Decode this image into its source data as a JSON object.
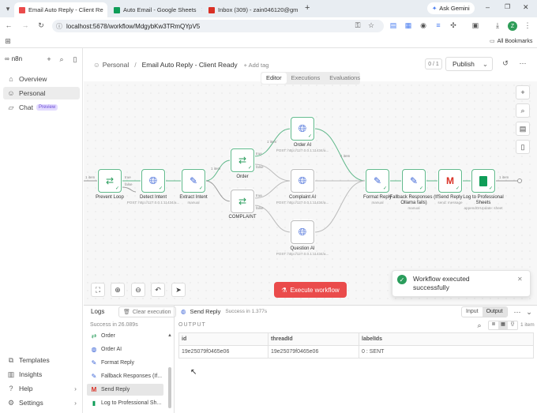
{
  "browser": {
    "tabs": [
      {
        "title": "Email Auto Reply - Client Re",
        "fav_color": "#ea4b4b",
        "active": true
      },
      {
        "title": "Auto Email - Google Sheets",
        "fav_color": "#0f9d58",
        "active": false
      },
      {
        "title": "Inbox (309) - zain046120@gm",
        "fav_color": "#d93025",
        "active": false
      }
    ],
    "ask_gemini": "Ask Gemini",
    "url": "localhost:5678/workflow/MdgybKw3TRmQYpV5",
    "all_bookmarks": "All Bookmarks",
    "profile_initial": "Z"
  },
  "sidebar": {
    "logo": "n8n",
    "items": [
      {
        "label": "Overview",
        "icon": "home-icon"
      },
      {
        "label": "Personal",
        "icon": "user-icon"
      },
      {
        "label": "Chat",
        "icon": "chat-icon",
        "badge": "Preview"
      }
    ],
    "bottom_items": [
      {
        "label": "Templates",
        "icon": "templates-icon"
      },
      {
        "label": "Insights",
        "icon": "insights-icon"
      },
      {
        "label": "Help",
        "icon": "help-icon"
      },
      {
        "label": "Settings",
        "icon": "settings-icon"
      }
    ]
  },
  "header": {
    "breadcrumb_project": "Personal",
    "workflow_name": "Email Auto Reply - Client Ready",
    "add_tag": "+ Add tag",
    "counter": "0 / 1",
    "publish": "Publish",
    "tabs": [
      {
        "label": "Editor",
        "active": true
      },
      {
        "label": "Executions",
        "active": false
      },
      {
        "label": "Evaluations",
        "active": false
      }
    ]
  },
  "nodes": {
    "prevent_loop": {
      "label": "Prevent Loop",
      "sub": ""
    },
    "detect_intent": {
      "label": "Detect Intent",
      "sub": "POST: http://127.0.0.1:11434/a..."
    },
    "extract_intent": {
      "label": "Extract Intent",
      "sub": "manual"
    },
    "order": {
      "label": "Order",
      "sub": ""
    },
    "complaint": {
      "label": "COMPLAINT",
      "sub": ""
    },
    "order_ai": {
      "label": "Order AI",
      "sub": "POST: http://127.0.0.1:11434/a..."
    },
    "complaint_ai": {
      "label": "Complaint AI",
      "sub": "POST: http://127.0.0.1:11434/a..."
    },
    "question_ai": {
      "label": "Question AI",
      "sub": "POST: http://127.0.0.1:11434/a..."
    },
    "format_reply": {
      "label": "Format Reply",
      "sub": "manual"
    },
    "fallback": {
      "label": "Fallback Responses (If Ollama fails)",
      "sub": "manual"
    },
    "send_reply": {
      "label": "Send Reply",
      "sub": "send: message"
    },
    "log_sheets": {
      "label": "Log to Professional Sheets",
      "sub": "appendOrUpdate: sheet"
    }
  },
  "edges": {
    "item": "1 item",
    "true": "true",
    "false": "false"
  },
  "canvas": {
    "execute_button": "Execute workflow"
  },
  "toast": {
    "message": "Workflow executed successfully"
  },
  "logs": {
    "title": "Logs",
    "clear": "Clear execution",
    "status": "Success in 26.089s",
    "items": [
      {
        "label": "Order",
        "icon": "switch-icon"
      },
      {
        "label": "Order AI",
        "icon": "globe-icon"
      },
      {
        "label": "Format Reply",
        "icon": "edit-icon"
      },
      {
        "label": "Fallback Responses (If...",
        "icon": "edit-icon"
      },
      {
        "label": "Send Reply",
        "icon": "gmail-icon",
        "selected": true
      },
      {
        "label": "Log to Professional Sh...",
        "icon": "sheets-icon"
      }
    ],
    "detail_node": "Send Reply",
    "detail_status": "Success in 1.377s",
    "input_tab": "Input",
    "output_tab": "Output",
    "output_label": "OUTPUT",
    "item_count": "1 item",
    "columns": [
      "id",
      "threadId",
      "labelIds"
    ],
    "row": [
      "19e25079f0465e06",
      "19e25079f0465e06",
      "0 : SENT"
    ]
  }
}
